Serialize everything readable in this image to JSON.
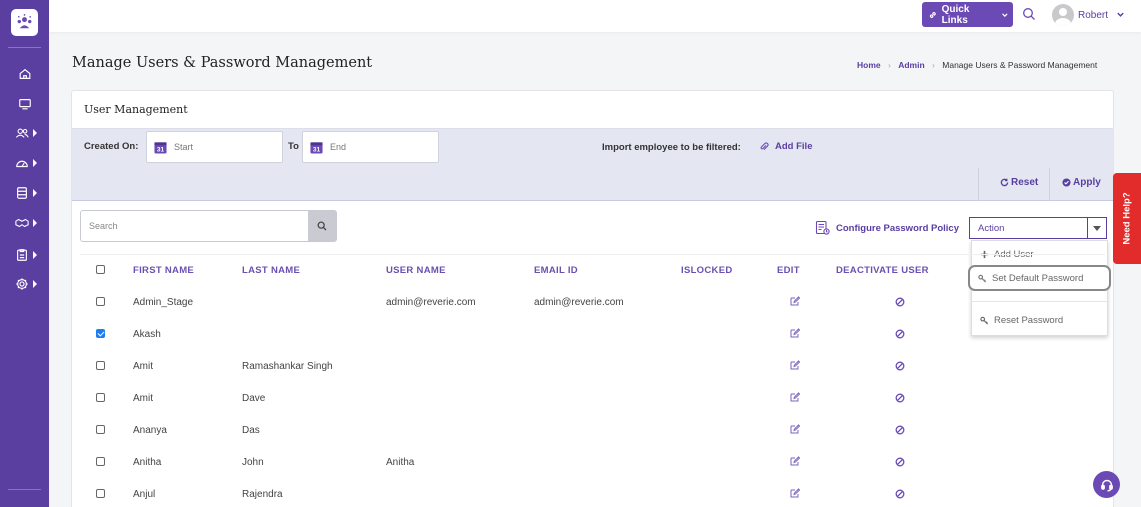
{
  "topbar": {
    "quick_links_label": "Quick Links",
    "user_name": "Robert"
  },
  "page": {
    "title": "Manage Users & Password Management",
    "breadcrumb": [
      "Home",
      "Admin",
      "Manage Users & Password Management"
    ]
  },
  "card": {
    "title": "User Management",
    "filters": {
      "created_on_label": "Created On:",
      "start_placeholder": "Start",
      "to_label": "To",
      "end_placeholder": "End",
      "import_label": "Import employee to be filtered:",
      "add_file_label": "Add File",
      "reset_label": "Reset",
      "apply_label": "Apply"
    },
    "search_placeholder": "Search",
    "configure_policy_label": "Configure Password Policy",
    "action": {
      "selected": "Action",
      "options": [
        "Add User",
        "Set Default Password",
        "Reset Password"
      ]
    }
  },
  "table": {
    "columns": [
      "FIRST NAME",
      "LAST NAME",
      "USER NAME",
      "EMAIL ID",
      "ISLOCKED",
      "EDIT",
      "DEACTIVATE USER"
    ],
    "rows": [
      {
        "first": "Admin_Stage",
        "last": "",
        "user": "admin@reverie.com",
        "email": "admin@reverie.com",
        "checked": false
      },
      {
        "first": "Akash",
        "last": "",
        "user": "",
        "email": "",
        "checked": true
      },
      {
        "first": "Amit",
        "last": "Ramashankar Singh",
        "user": "",
        "email": "",
        "checked": false
      },
      {
        "first": "Amit",
        "last": "Dave",
        "user": "",
        "email": "",
        "checked": false
      },
      {
        "first": "Ananya",
        "last": "Das",
        "user": "",
        "email": "",
        "checked": false
      },
      {
        "first": "Anitha",
        "last": "John",
        "user": "Anitha",
        "email": "",
        "checked": false
      },
      {
        "first": "Anjul",
        "last": "Rajendra",
        "user": "",
        "email": "",
        "checked": false
      }
    ]
  },
  "help": {
    "need_help_label": "Need Help?"
  },
  "colors": {
    "sidebar": "#5b3fa0",
    "accent": "#6c4ab6",
    "need_help": "#e22b2b",
    "checkbox_checked": "#1d7df0"
  }
}
